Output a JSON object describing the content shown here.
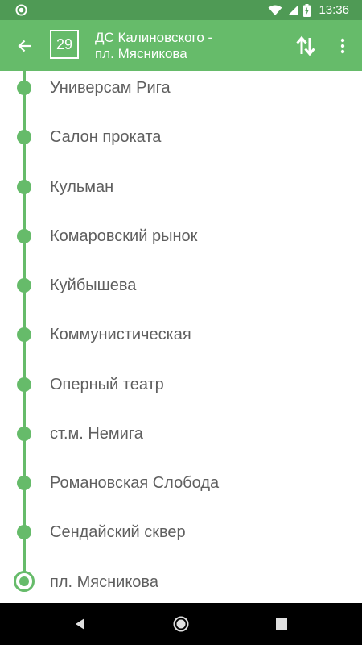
{
  "status_bar": {
    "time": "13:36",
    "icons": [
      "app-notification-icon",
      "wifi-icon",
      "signal-icon",
      "battery-charging-icon"
    ]
  },
  "app_bar": {
    "route_number": "29",
    "title": "ДС Калиновского -\nпл. Мясникова",
    "icons": [
      "back-arrow-icon",
      "swap-direction-icon",
      "more-vert-icon"
    ],
    "color": "#66bb6a",
    "status_color": "#4f9a55"
  },
  "stops": [
    {
      "name": "Универсам Рига"
    },
    {
      "name": "Салон проката"
    },
    {
      "name": "Кульман"
    },
    {
      "name": "Комаровский рынок"
    },
    {
      "name": "Куйбышева"
    },
    {
      "name": "Коммунистическая"
    },
    {
      "name": "Оперный театр"
    },
    {
      "name": "ст.м. Немига"
    },
    {
      "name": "Романовская Слобода"
    },
    {
      "name": "Сендайский сквер"
    },
    {
      "name": "пл. Мясникова",
      "final": true
    }
  ],
  "nav_bar": {
    "icons": [
      "nav-back-icon",
      "nav-home-icon",
      "nav-recents-icon"
    ]
  }
}
